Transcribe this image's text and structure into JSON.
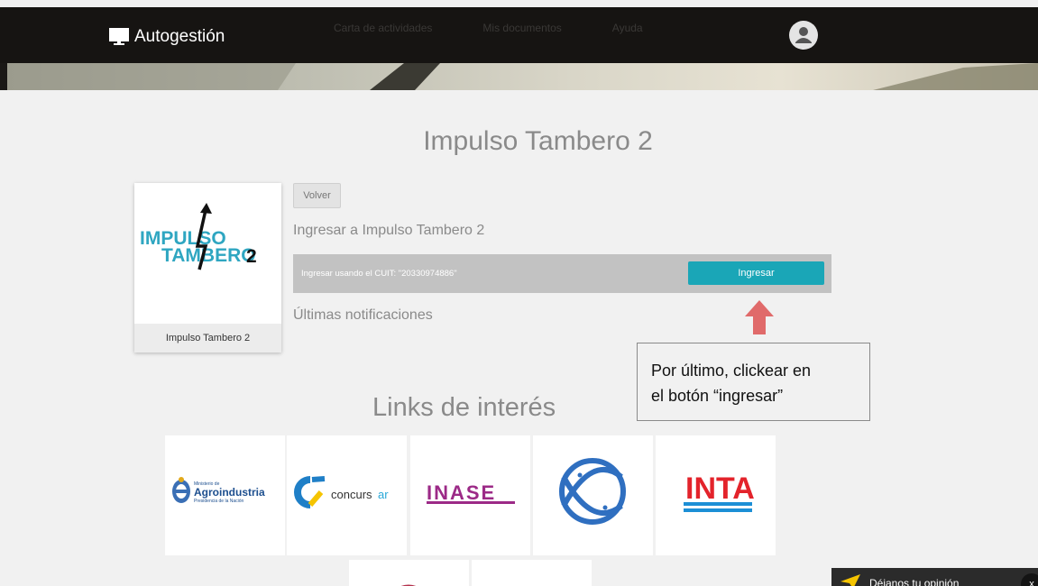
{
  "header": {
    "brand": "Autogestión",
    "nav": [
      "Carta de actividades",
      "Mis documentos",
      "Ayuda"
    ]
  },
  "main": {
    "title": "Impulso Tambero 2",
    "card": {
      "logo_line1": "IMPULSO",
      "logo_line2": "TAMBERO",
      "logo_digit": "2",
      "caption": "Impulso Tambero 2"
    },
    "back_label": "Volver",
    "subheading": "Ingresar a Impulso Tambero 2",
    "cuit_text": "Ingresar usando el CUIT: \"20330974886\"",
    "ingresar_label": "Ingresar",
    "notifications_heading": "Últimas notificaciones"
  },
  "callout": {
    "line1": "Por último, clickear en",
    "line2": "el botón “ingresar”"
  },
  "links": {
    "title": "Links de interés",
    "agro_small": "Ministerio de",
    "agro_big": "Agroindustria",
    "agro_sub": "Presidencia de la Nación",
    "concursar": "concurs",
    "concursar_ar": "ar",
    "inase": "INASE",
    "inta": "INTA"
  },
  "feedback": {
    "label": "Déjanos tu opinión",
    "close": "x"
  },
  "colors": {
    "accent": "#1aa6b7",
    "arrow": "#e06a6a",
    "header": "#161412"
  }
}
